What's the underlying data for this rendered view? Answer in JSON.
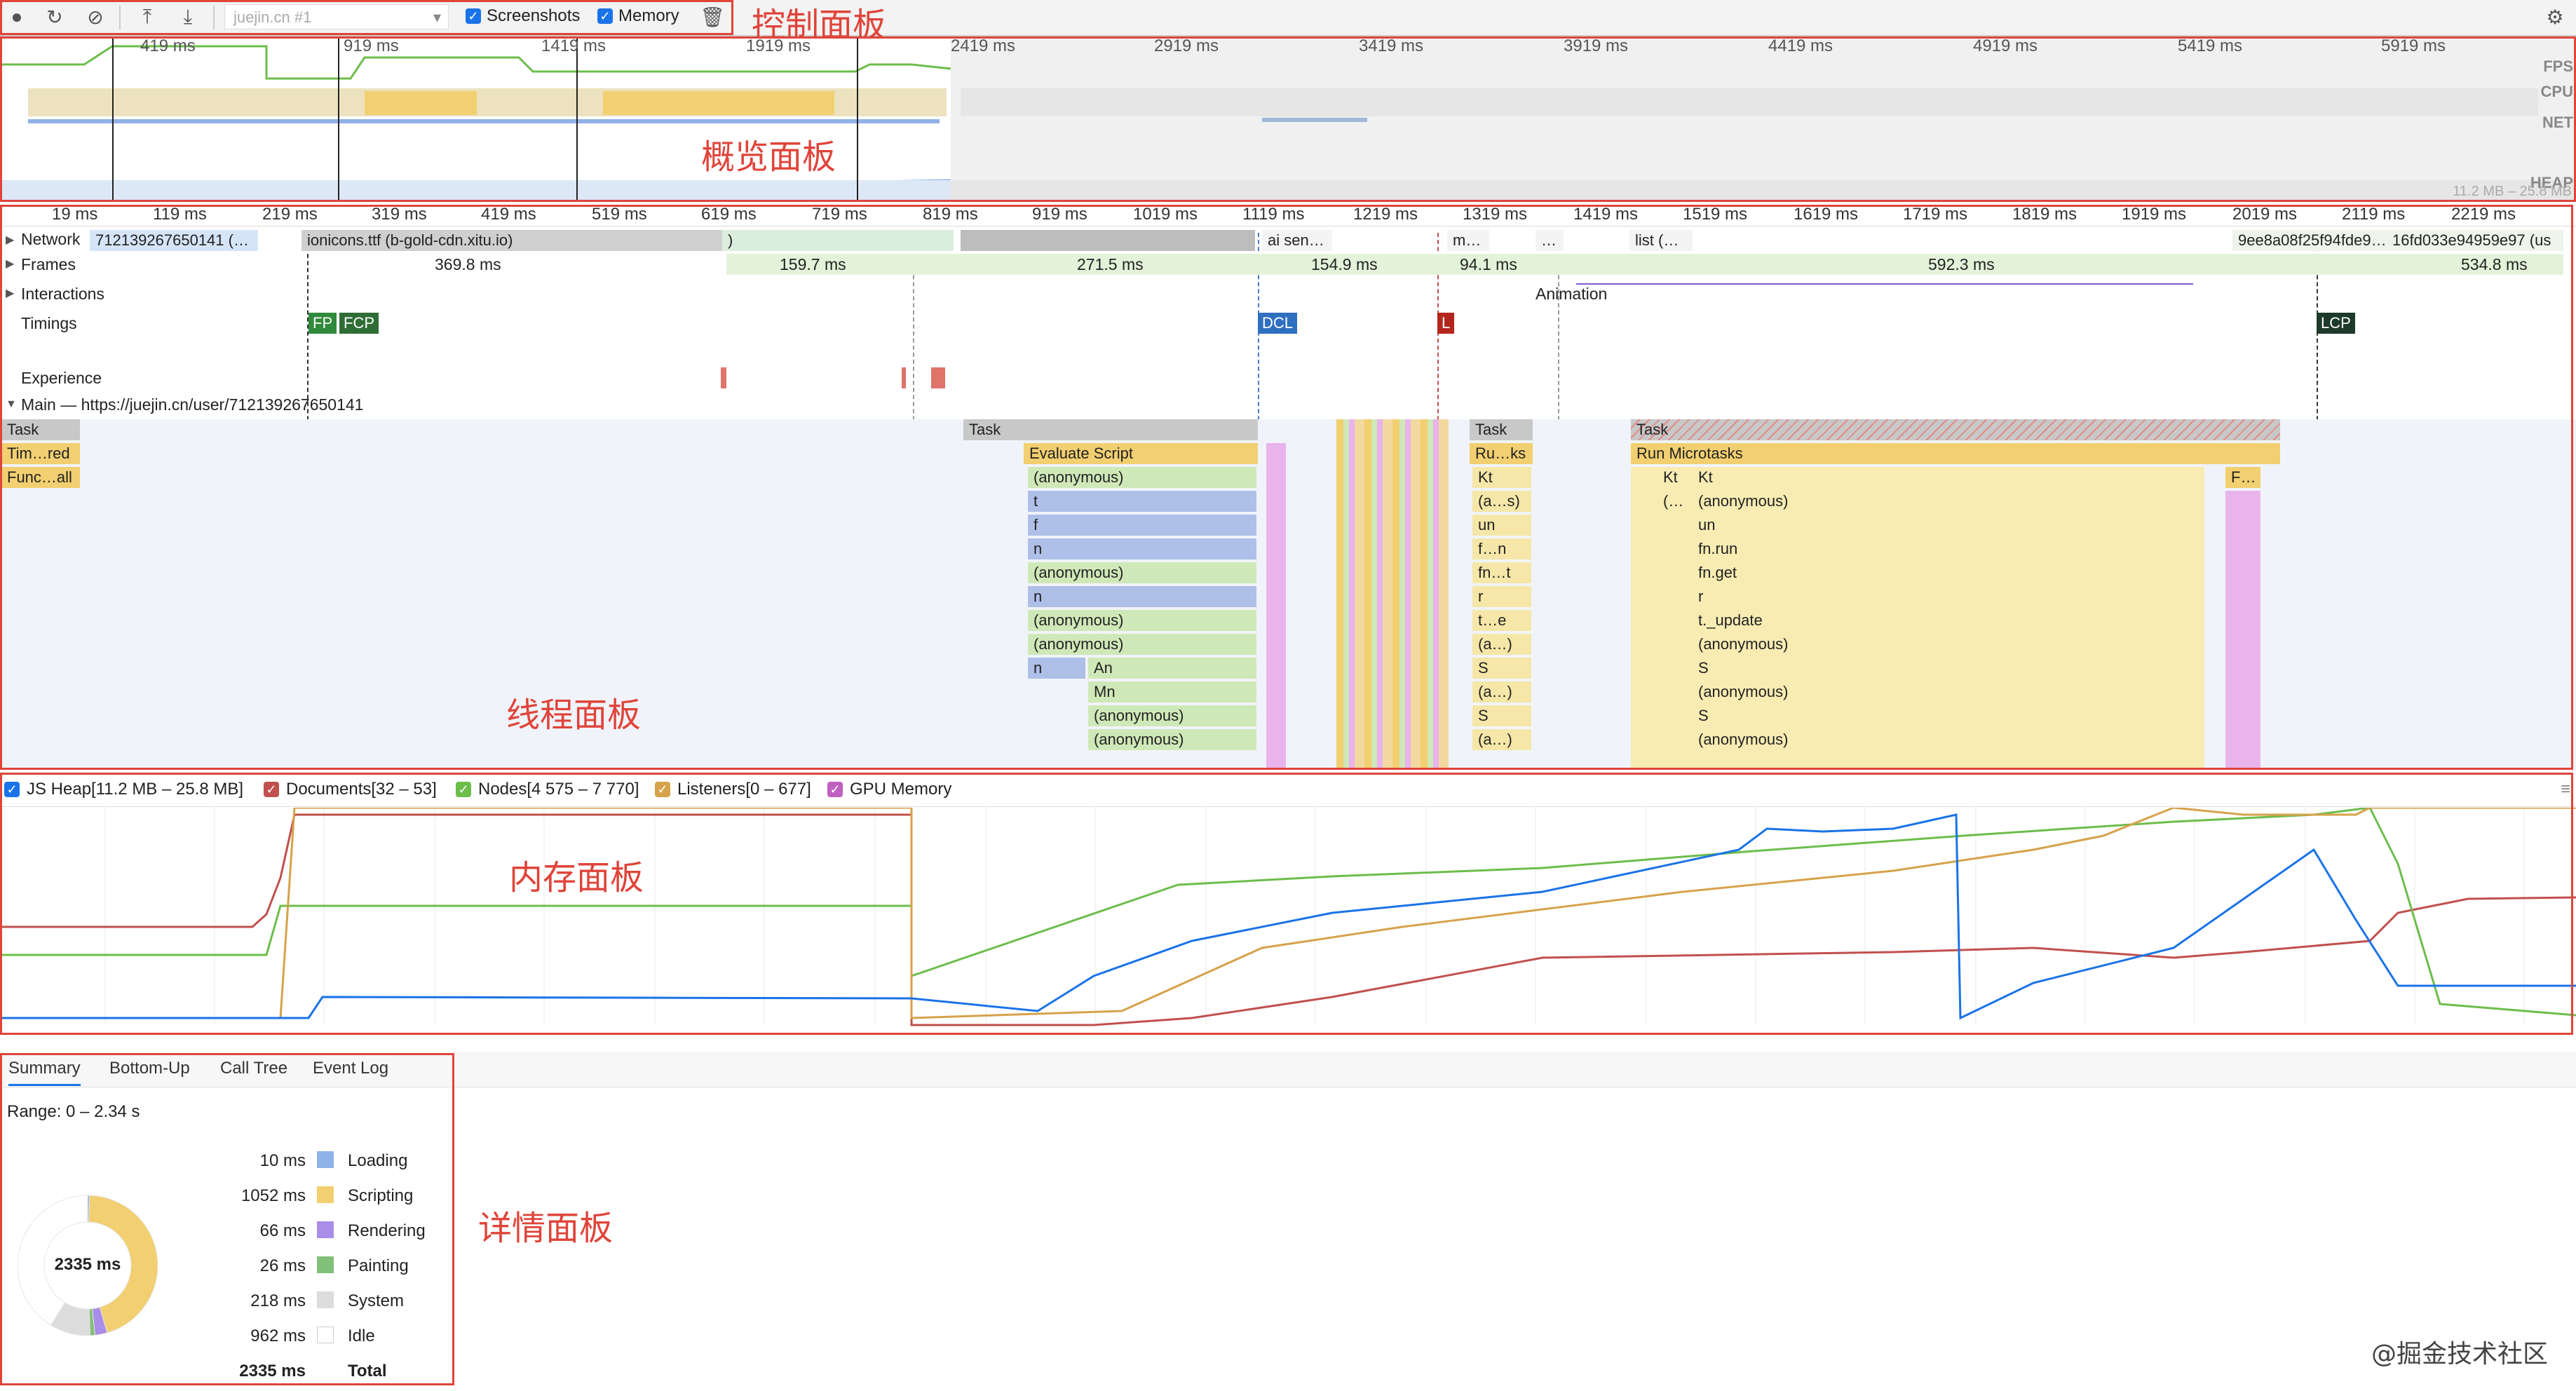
{
  "annotations": {
    "control": "控制面板",
    "overview": "概览面板",
    "thread": "线程面板",
    "memory": "内存面板",
    "details": "详情面板"
  },
  "toolbar": {
    "url_select": "juejin.cn #1",
    "screenshots_label": "Screenshots",
    "memory_label": "Memory",
    "screenshots_checked": true,
    "memory_checked": true
  },
  "overview": {
    "ticks": [
      "419 ms",
      "919 ms",
      "1419 ms",
      "1919 ms",
      "2419 ms",
      "2919 ms",
      "3419 ms",
      "3919 ms",
      "4419 ms",
      "4919 ms",
      "5419 ms",
      "5919 ms"
    ],
    "lanes": [
      "FPS",
      "CPU",
      "NET",
      "HEAP"
    ],
    "heap_range": "11.2 MB – 25.8 MB"
  },
  "ruler": {
    "ticks": [
      "19 ms",
      "119 ms",
      "219 ms",
      "319 ms",
      "419 ms",
      "519 ms",
      "619 ms",
      "719 ms",
      "819 ms",
      "919 ms",
      "1019 ms",
      "1119 ms",
      "1219 ms",
      "1319 ms",
      "1419 ms",
      "1519 ms",
      "1619 ms",
      "1719 ms",
      "1819 ms",
      "1919 ms",
      "2019 ms",
      "2119 ms",
      "2219 ms"
    ]
  },
  "tracks": {
    "network_label": "Network",
    "network_items": [
      "712139267650141 (…",
      "ionicons.ttf (b-gold-cdn.xitu.io)",
      ")",
      "ai sen…",
      "m…",
      "…",
      "list (…",
      "9ee8a08f25f94fde9…",
      "16fd033e94959e97 (us"
    ],
    "frames_label": "Frames",
    "frames": [
      "369.8 ms",
      "159.7 ms",
      "271.5 ms",
      "154.9 ms",
      "94.1 ms",
      "592.3 ms",
      "534.8 ms"
    ],
    "interactions_label": "Interactions",
    "interaction_animation": "Animation",
    "timings_label": "Timings",
    "timings": {
      "fp": "FP",
      "fcp": "FCP",
      "dcl": "DCL",
      "l": "L",
      "lcp": "LCP"
    },
    "experience_label": "Experience",
    "main_label": "Main — https://juejin.cn/user/712139267650141"
  },
  "flame": {
    "left": [
      "Task",
      "Tim…red",
      "Func…all"
    ],
    "eval_task": "Task",
    "eval_script": "Evaluate Script",
    "eval_stack": [
      "(anonymous)",
      "t",
      "f",
      "n",
      "(anonymous)",
      "n",
      "(anonymous)",
      "(anonymous)",
      "n",
      "",
      "(anonymous)",
      "(anonymous)"
    ],
    "eval_sub": [
      "An",
      "Mn",
      "(anonymous)",
      "(anonymous)"
    ],
    "mid_task": "Task",
    "mid_run": "Ru…ks",
    "mid_stack": [
      "Kt",
      "(a…s)",
      "un",
      "f…n",
      "fn…t",
      "r",
      "t…e",
      "(a…)",
      "S",
      "(a…)",
      "S",
      "(a…)"
    ],
    "micro_task": "Task",
    "micro_run": "Run Microtasks",
    "micro_kt": [
      "Kt",
      "(…"
    ],
    "micro_stack": [
      "Kt",
      "(anonymous)",
      "un",
      "fn.run",
      "fn.get",
      "r",
      "t._update",
      "(anonymous)",
      "S",
      "(anonymous)",
      "S",
      "(anonymous)"
    ],
    "micro_f": "F…"
  },
  "memory": {
    "legend": [
      {
        "label": "JS Heap[11.2 MB – 25.8 MB]",
        "color": "#1a73e8"
      },
      {
        "label": "Documents[32 – 53]",
        "color": "#c0504d"
      },
      {
        "label": "Nodes[4 575 – 7 770]",
        "color": "#6dbd4b"
      },
      {
        "label": "Listeners[0 – 677]",
        "color": "#d6a24a"
      },
      {
        "label": "GPU Memory",
        "color": "#c060c0"
      }
    ]
  },
  "details": {
    "tabs": [
      "Summary",
      "Bottom-Up",
      "Call Tree",
      "Event Log"
    ],
    "range": "Range: 0 – 2.34 s",
    "center_total": "2335 ms",
    "rows": [
      {
        "value": "10 ms",
        "label": "Loading",
        "color": "#8fb2e8"
      },
      {
        "value": "1052 ms",
        "label": "Scripting",
        "color": "#f2cf70"
      },
      {
        "value": "66 ms",
        "label": "Rendering",
        "color": "#a98de8"
      },
      {
        "value": "26 ms",
        "label": "Painting",
        "color": "#80c078"
      },
      {
        "value": "218 ms",
        "label": "System",
        "color": "#dcdcdc"
      },
      {
        "value": "962 ms",
        "label": "Idle",
        "color": "#ffffff"
      }
    ],
    "total_value": "2335 ms",
    "total_label": "Total",
    "pie": [
      10,
      1052,
      66,
      26,
      218,
      962
    ]
  },
  "watermark": "@掘金技术社区"
}
